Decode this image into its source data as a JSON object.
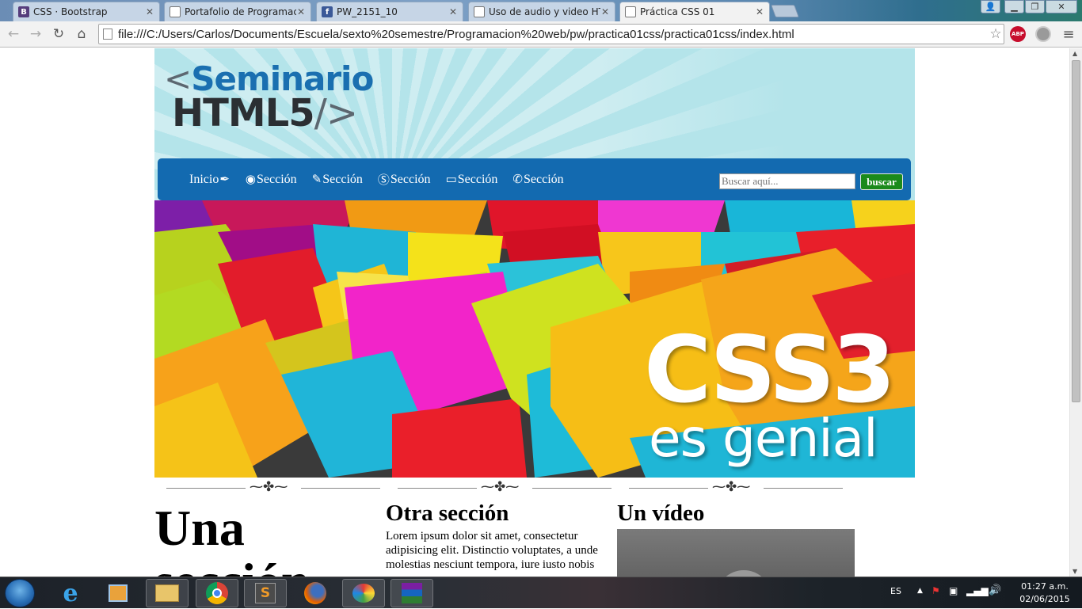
{
  "browser": {
    "tabs": [
      {
        "title": "CSS · Bootstrap",
        "favicon": "bootstrap-icon",
        "color": "#563d7c",
        "glyph": "B"
      },
      {
        "title": "Portafolio de Programacio",
        "favicon": "document-icon",
        "color": "#ffffff",
        "glyph": ""
      },
      {
        "title": "PW_2151_10",
        "favicon": "facebook-icon",
        "color": "#3b5998",
        "glyph": "f"
      },
      {
        "title": "Uso de audio y video HTM",
        "favicon": "document-icon",
        "color": "#ffffff",
        "glyph": ""
      },
      {
        "title": "Práctica CSS 01",
        "favicon": "document-icon",
        "color": "#ffffff",
        "glyph": ""
      }
    ],
    "active_tab": 4,
    "url": "file:///C:/Users/Carlos/Documents/Escuela/sexto%20semestre/Programacion%20web/pw/practica01css/practica01css/index.html",
    "extensions": [
      {
        "name": "adblock-plus-icon",
        "label": "ABP",
        "color": "#c70d2c"
      },
      {
        "name": "extension-icon",
        "label": "",
        "color": "#9a9a9a"
      }
    ]
  },
  "site": {
    "logo": {
      "bracket_open": "<",
      "line1": "Seminario",
      "line2": "HTML5",
      "bracket_close": "/>"
    },
    "nav": [
      {
        "label": "Inicio",
        "icon": "quill-icon",
        "glyph": "✒",
        "icon_after": true
      },
      {
        "label": "Sección",
        "icon": "podcast-icon",
        "glyph": "◉",
        "icon_after": false
      },
      {
        "label": "Sección",
        "icon": "ticket-icon",
        "glyph": "✎",
        "icon_after": false
      },
      {
        "label": "Sección",
        "icon": "coin-icon",
        "glyph": "$",
        "icon_after": false
      },
      {
        "label": "Sección",
        "icon": "credit-card-icon",
        "glyph": "▭",
        "icon_after": false
      },
      {
        "label": "Sección",
        "icon": "phone-icon",
        "glyph": "☎",
        "icon_after": false
      }
    ],
    "search": {
      "placeholder": "Buscar aquí...",
      "button": "buscar"
    },
    "hero": {
      "line1": "CSS3",
      "line2": "es genial"
    },
    "sections": [
      {
        "heading": "Una",
        "continuation": "sección"
      },
      {
        "heading": "Otra sección",
        "text": "Lorem ipsum dolor sit amet, consectetur adipisicing elit. Distinctio voluptates, a unde molestias nesciunt tempora, iure iusto nobis"
      },
      {
        "heading": "Un vídeo"
      }
    ]
  },
  "taskbar": {
    "apps": [
      {
        "name": "internet-explorer-icon",
        "pinned": false
      },
      {
        "name": "media-center-icon",
        "pinned": false
      },
      {
        "name": "file-explorer-icon",
        "pinned": true
      },
      {
        "name": "chrome-icon",
        "pinned": true
      },
      {
        "name": "sublime-text-icon",
        "pinned": true
      },
      {
        "name": "firefox-icon",
        "pinned": false
      },
      {
        "name": "paint-icon",
        "pinned": true
      },
      {
        "name": "winrar-icon",
        "pinned": true
      }
    ],
    "language": "ES",
    "time": "01:27 a.m.",
    "date": "02/06/2015"
  },
  "colors": {
    "nav_bg": "#136ab0",
    "header_bg": "#b4e4ea",
    "search_button": "#1b8a1b",
    "logo_blue": "#1a6fb0"
  }
}
